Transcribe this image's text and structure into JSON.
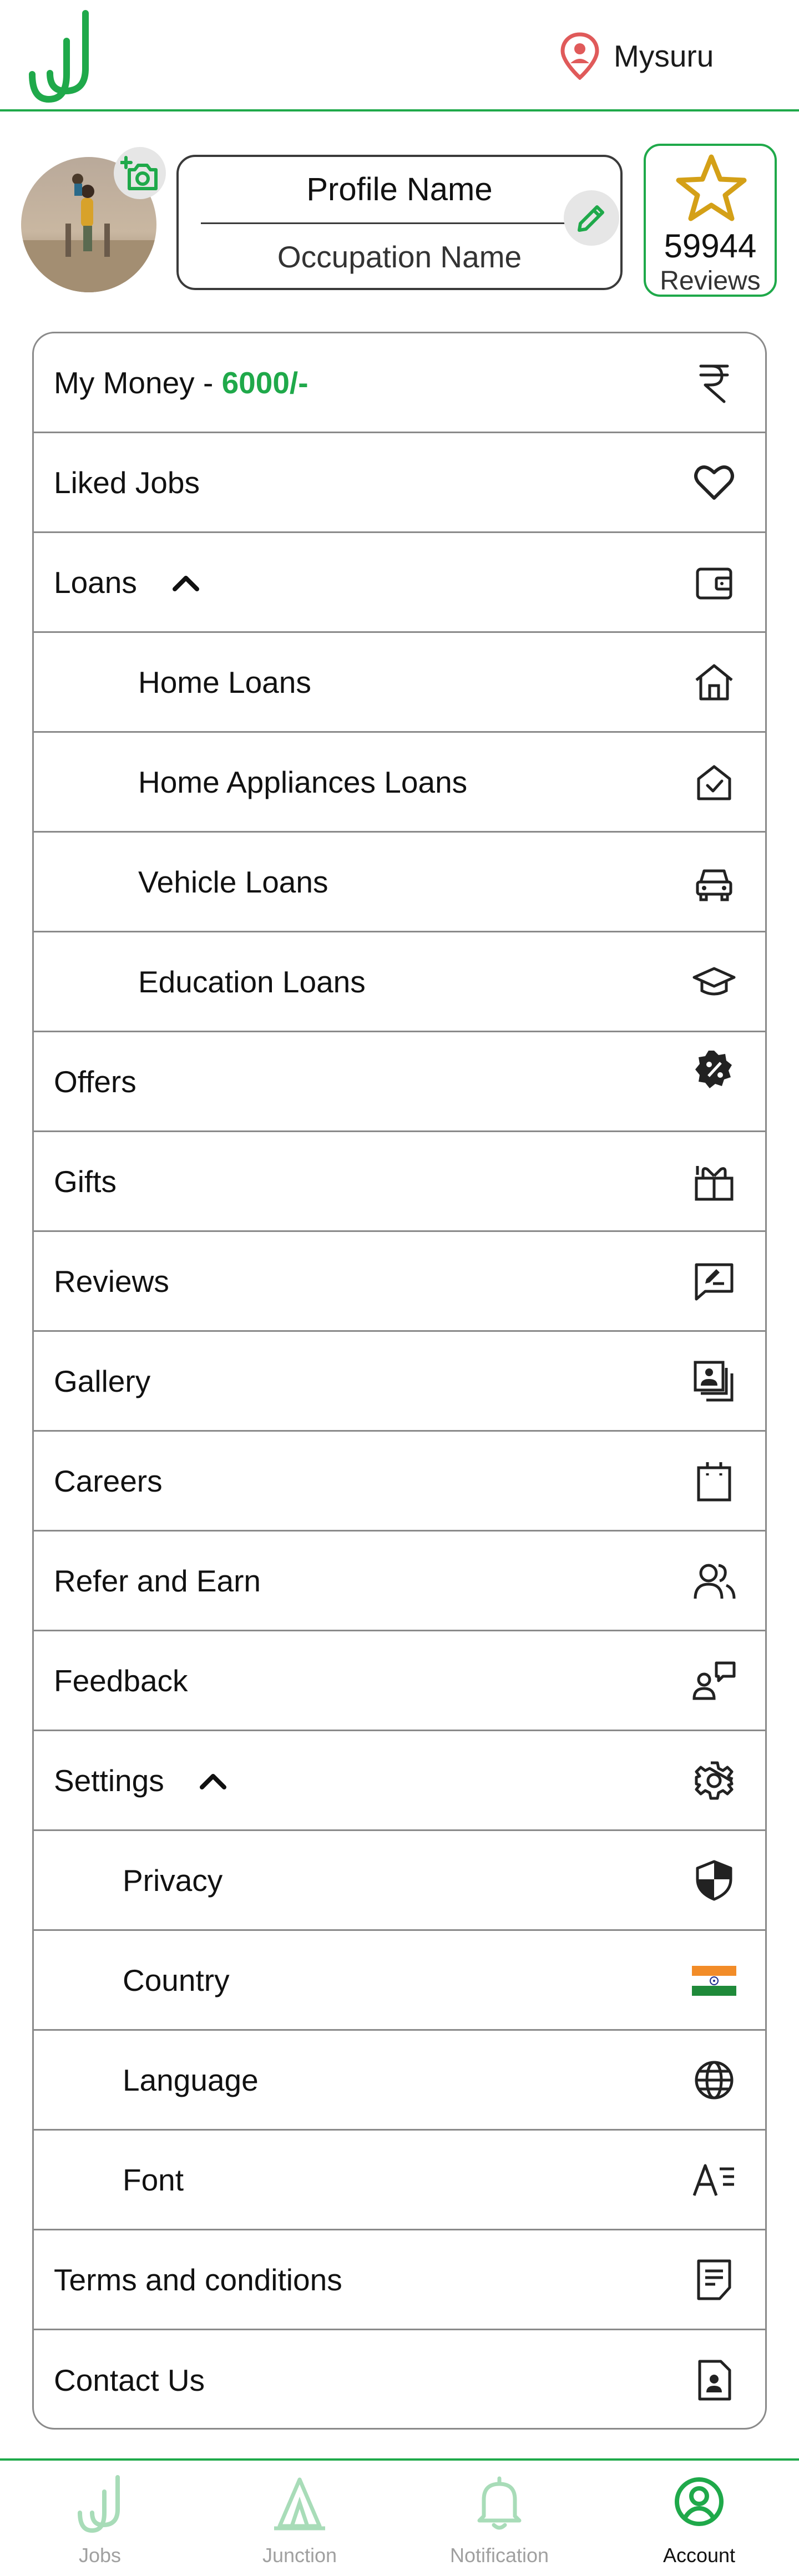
{
  "header": {
    "location": "Mysuru",
    "brand_color": "#1fa94a",
    "location_pin_color": "#e05a5a"
  },
  "profile": {
    "name": "Profile Name",
    "occupation": "Occupation Name",
    "reviews_count": "59944",
    "reviews_label": "Reviews",
    "star_color": "#d4a017"
  },
  "menu": {
    "my_money_label": "My Money  -  ",
    "my_money_value": "6000/-",
    "items": {
      "liked_jobs": "Liked Jobs",
      "loans": "Loans",
      "home_loans": "Home Loans",
      "home_appliances_loans": "Home Appliances Loans",
      "vehicle_loans": "Vehicle Loans",
      "education_loans": "Education Loans",
      "offers": "Offers",
      "gifts": "Gifts",
      "reviews": "Reviews",
      "gallery": "Gallery",
      "careers": "Careers",
      "refer_and_earn": "Refer and Earn",
      "feedback": "Feedback",
      "settings": "Settings",
      "privacy": "Privacy",
      "country": "Country",
      "language": "Language",
      "font": "Font",
      "terms": "Terms and conditions",
      "contact": "Contact Us"
    }
  },
  "bottom_nav": {
    "jobs": "Jobs",
    "junction": "Junction",
    "notification": "Notification",
    "account": "Account",
    "inactive_color": "#a8dcb8"
  }
}
